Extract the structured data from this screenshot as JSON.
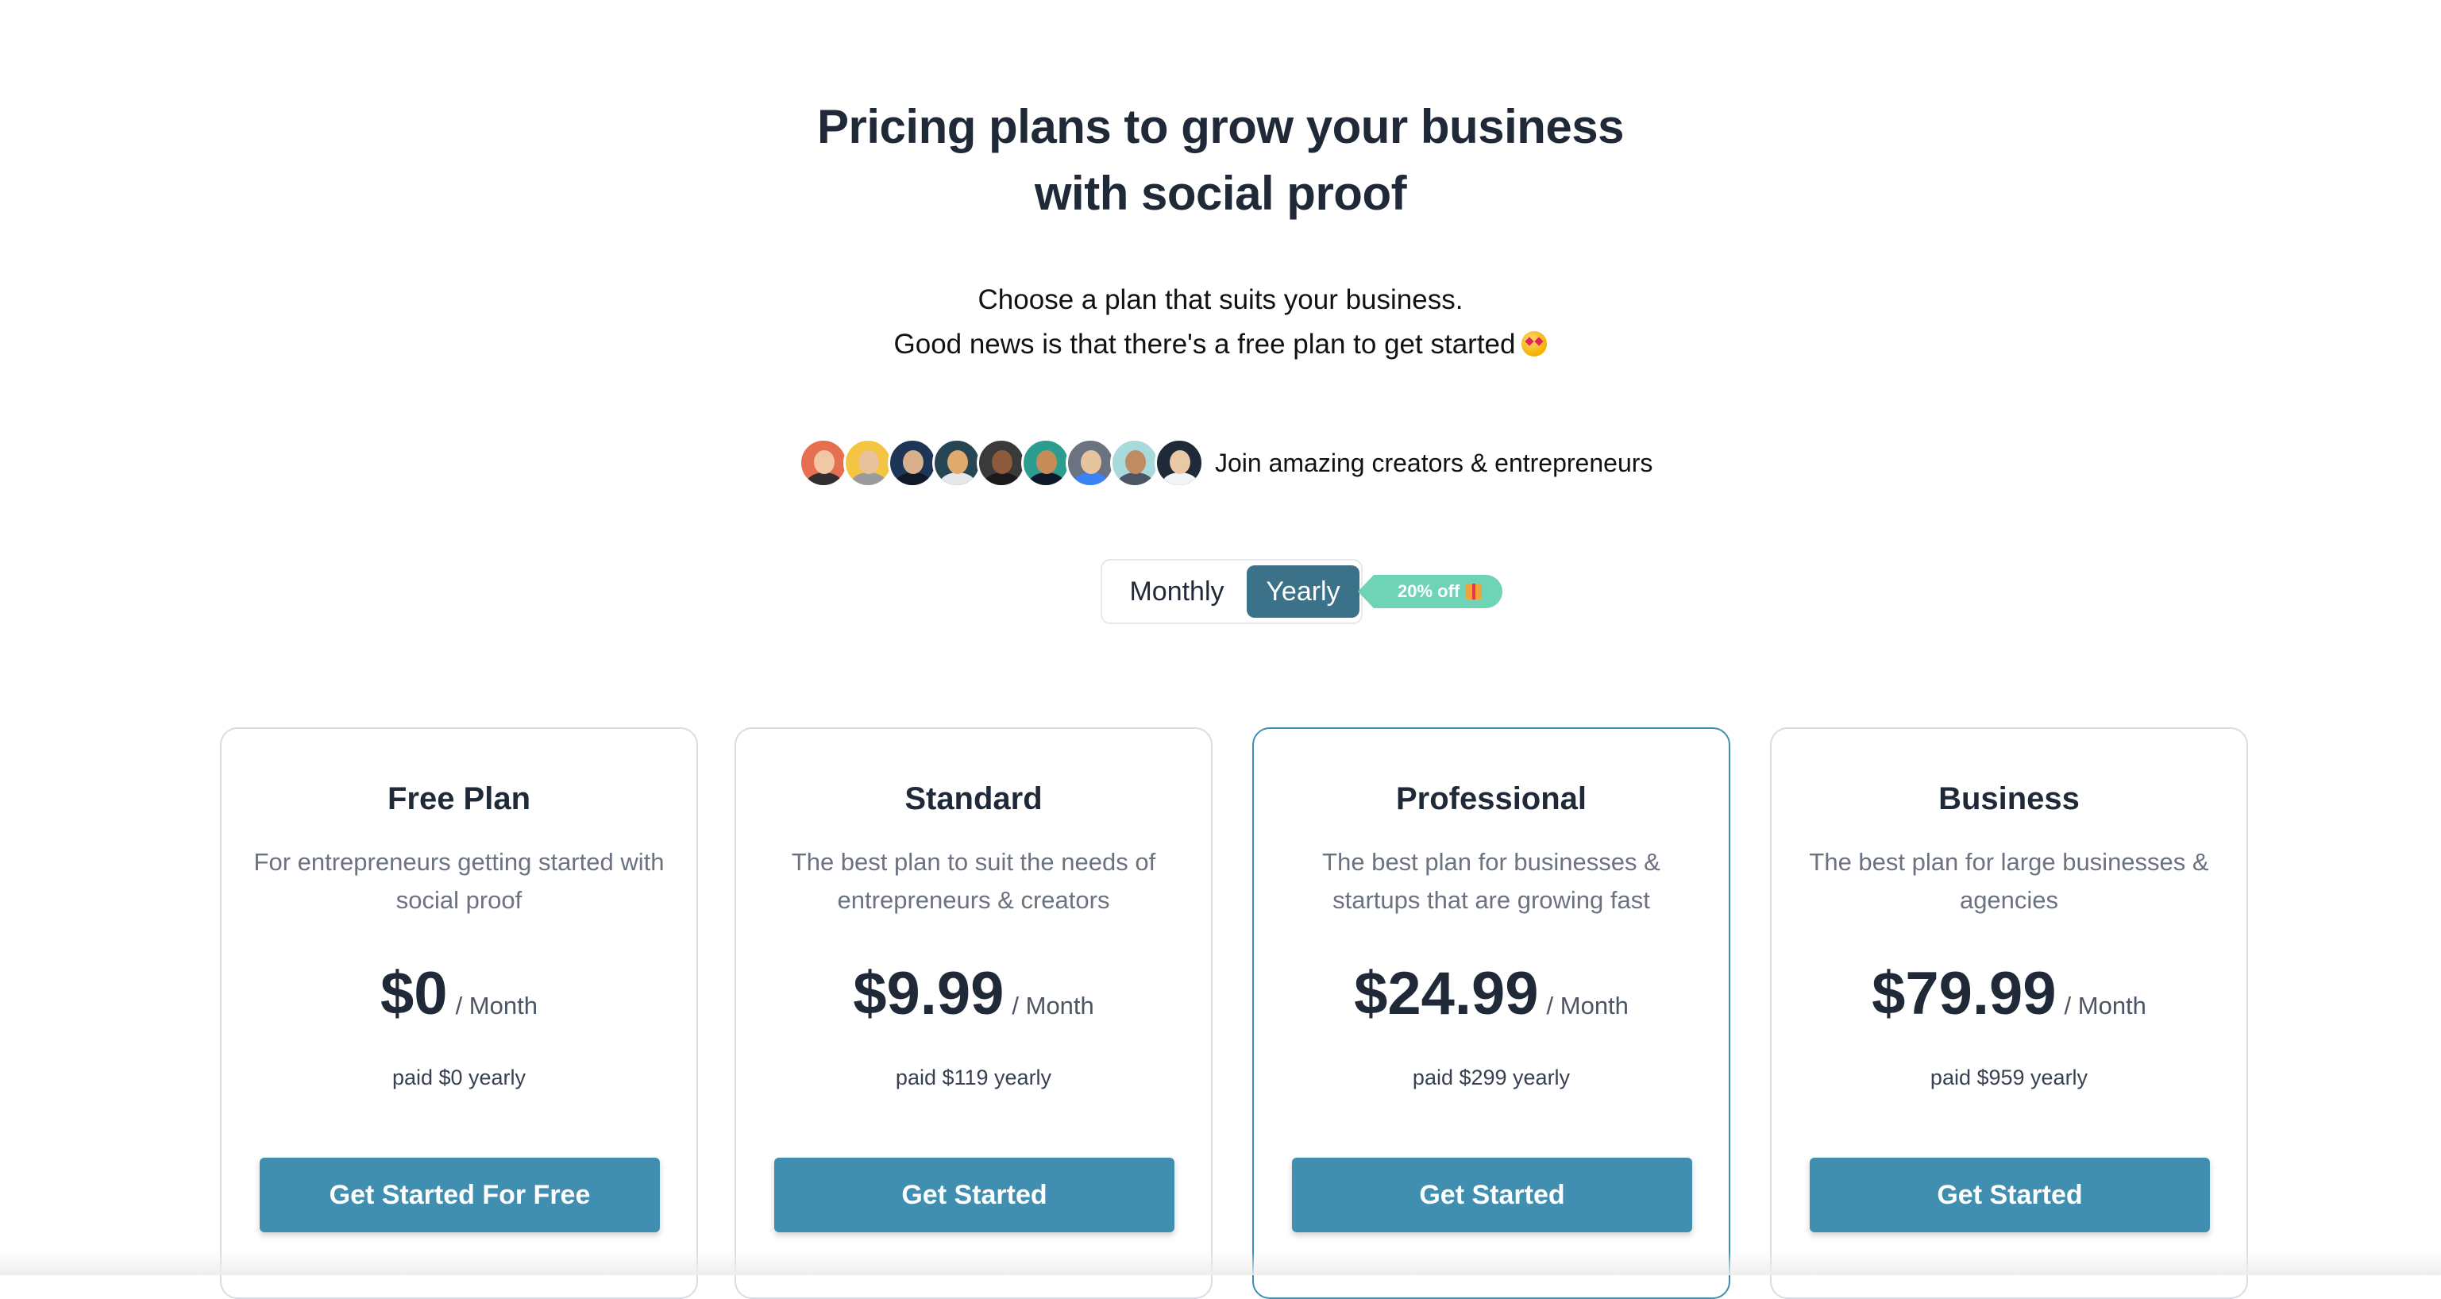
{
  "header": {
    "headline_line1": "Pricing plans to grow your business",
    "headline_line2": "with social proof",
    "subtitle_line1": "Choose a plan that suits your business.",
    "subtitle_line2": "Good news is that there's a free plan to get started"
  },
  "social_proof": {
    "text": "Join amazing creators & entrepreneurs",
    "avatars": [
      {
        "name": "avatar-1",
        "bg": "#e76f51",
        "skin": "#f1c7a4",
        "shirt": "#2f2f2f"
      },
      {
        "name": "avatar-2",
        "bg": "#f4c542",
        "skin": "#e8c29a",
        "shirt": "#9b9b9b"
      },
      {
        "name": "avatar-3",
        "bg": "#1d3557",
        "skin": "#d9b08c",
        "shirt": "#111827"
      },
      {
        "name": "avatar-4",
        "bg": "#264653",
        "skin": "#e0a96d",
        "shirt": "#e5e7eb"
      },
      {
        "name": "avatar-5",
        "bg": "#3a3a3a",
        "skin": "#8d5a3b",
        "shirt": "#1a1a1a"
      },
      {
        "name": "avatar-6",
        "bg": "#2a9d8f",
        "skin": "#c68b59",
        "shirt": "#0f172a"
      },
      {
        "name": "avatar-7",
        "bg": "#6b7280",
        "skin": "#e7c4a0",
        "shirt": "#3b82f6"
      },
      {
        "name": "avatar-8",
        "bg": "#a8dadc",
        "skin": "#c08a62",
        "shirt": "#4b5563"
      },
      {
        "name": "avatar-9",
        "bg": "#1f2937",
        "skin": "#e9c8a6",
        "shirt": "#f3f4f6"
      }
    ]
  },
  "billing_toggle": {
    "monthly_label": "Monthly",
    "yearly_label": "Yearly",
    "selected": "Yearly",
    "discount_badge": "20% off"
  },
  "plans": [
    {
      "title": "Free Plan",
      "description": "For entrepreneurs getting started with social proof",
      "price": "$0",
      "period": "/ Month",
      "paid": "paid $0 yearly",
      "button": "Get Started For Free",
      "featured": false
    },
    {
      "title": "Standard",
      "description": "The best plan to suit the needs of entrepreneurs & creators",
      "price": "$9.99",
      "period": "/ Month",
      "paid": "paid $119 yearly",
      "button": "Get Started",
      "featured": false
    },
    {
      "title": "Professional",
      "description": "The best plan for businesses & startups that are growing fast",
      "price": "$24.99",
      "period": "/ Month",
      "paid": "paid $299 yearly",
      "button": "Get Started",
      "featured": true
    },
    {
      "title": "Business",
      "description": "The best plan for large businesses & agencies",
      "price": "$79.99",
      "period": "/ Month",
      "paid": "paid $959 yearly",
      "button": "Get Started",
      "featured": false
    }
  ],
  "colors": {
    "accent": "#418fb0",
    "toggle_active": "#3b7189",
    "badge": "#6fd3b5",
    "featured_border": "#3f8fb5"
  }
}
